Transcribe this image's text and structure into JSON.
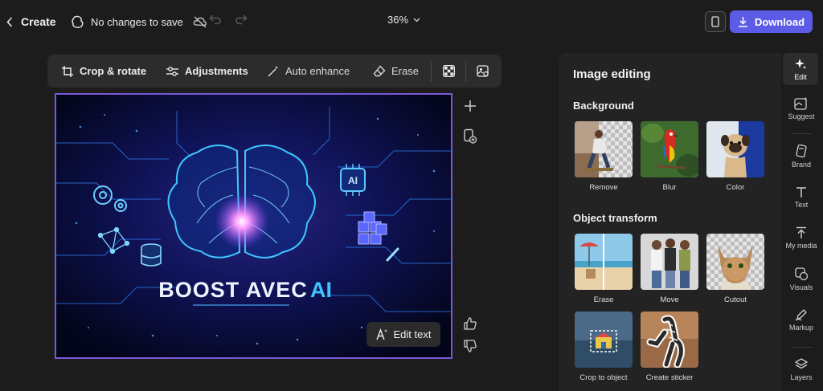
{
  "header": {
    "back_label": "Create",
    "save_status": "No changes to save",
    "zoom": "36%",
    "download_label": "Download"
  },
  "toolbar": {
    "crop_label": "Crop & rotate",
    "adjustments_label": "Adjustments",
    "auto_enhance_label": "Auto enhance",
    "erase_label": "Erase"
  },
  "canvas": {
    "headline_word": "BOOST AVEC",
    "headline_accent": "AI",
    "chip_label": "AI",
    "edit_text_label": "Edit text"
  },
  "panel": {
    "title": "Image editing",
    "background_title": "Background",
    "background_items": [
      {
        "label": "Remove"
      },
      {
        "label": "Blur"
      },
      {
        "label": "Color"
      }
    ],
    "object_title": "Object transform",
    "object_items": [
      {
        "label": "Erase"
      },
      {
        "label": "Move"
      },
      {
        "label": "Cutout"
      },
      {
        "label": "Crop to object"
      },
      {
        "label": "Create sticker"
      }
    ]
  },
  "rail": {
    "items": [
      {
        "label": "Edit",
        "icon": "sparkle-icon"
      },
      {
        "label": "Suggest",
        "icon": "suggest-icon"
      },
      {
        "label": "Brand",
        "icon": "brand-icon"
      },
      {
        "label": "Text",
        "icon": "text-icon"
      },
      {
        "label": "My media",
        "icon": "upload-icon"
      },
      {
        "label": "Visuals",
        "icon": "visuals-icon"
      },
      {
        "label": "Markup",
        "icon": "markup-icon"
      },
      {
        "label": "Layers",
        "icon": "layers-icon"
      }
    ]
  },
  "colors": {
    "accent": "#5b5be6",
    "canvas_border": "#7a58d6",
    "panel_bg": "#232323",
    "app_bg": "#1c1c1c"
  }
}
